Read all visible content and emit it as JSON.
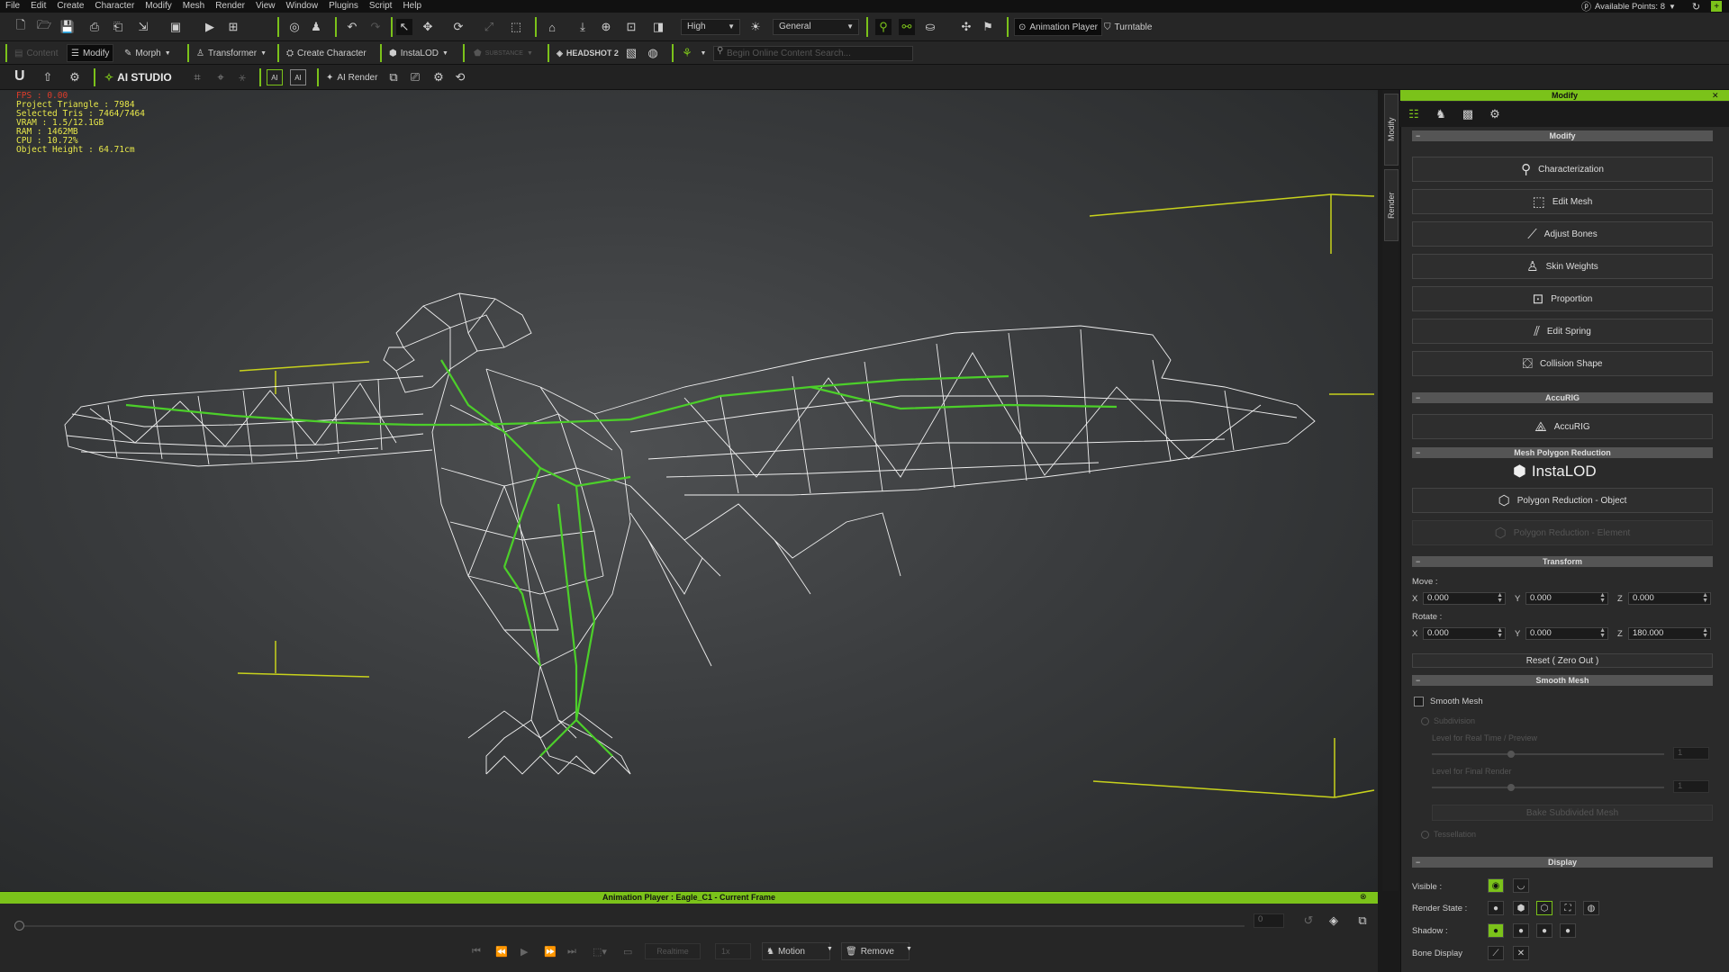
{
  "menu": [
    "File",
    "Edit",
    "Create",
    "Character",
    "Modify",
    "Mesh",
    "Render",
    "View",
    "Window",
    "Plugins",
    "Script",
    "Help"
  ],
  "points": {
    "label": "Available Points: 8"
  },
  "toolbar1": {
    "quality": "High",
    "lighting": "General",
    "animation_player": "Animation Player",
    "turntable": "Turntable"
  },
  "toolbar2": {
    "content": "Content",
    "modify": "Modify",
    "morph": "Morph",
    "transformer": "Transformer",
    "create_character": "Create Character",
    "instalod": "InstaLOD",
    "substance": "SUBSTANCE",
    "headshot": "HEADSHOT 2",
    "search_placeholder": "Begin Online Content Search..."
  },
  "toolbar3": {
    "ai_studio": "AI STUDIO",
    "ai_render": "AI Render"
  },
  "stats": {
    "fps": "FPS : 0.00",
    "tri": "Project Triangle : 7984",
    "sel": "Selected Tris : 7464/7464",
    "vram": "VRAM : 1.5/12.1GB",
    "ram": "RAM : 1462MB",
    "cpu": "CPU : 10.72%",
    "height": "Object Height : 64.71cm"
  },
  "side_tabs": {
    "modify": "Modify",
    "render": "Render"
  },
  "panel": {
    "title": "Modify",
    "sections": {
      "modify": "Modify",
      "accurig": "AccuRIG",
      "mpr": "Mesh Polygon Reduction",
      "transform": "Transform",
      "smooth": "Smooth Mesh",
      "display": "Display"
    },
    "modify_buttons": [
      "Characterization",
      "Edit Mesh",
      "Adjust Bones",
      "Skin Weights",
      "Proportion",
      "Edit Spring",
      "Collision Shape"
    ],
    "accurig_button": "AccuRIG",
    "instalod_logo": "InstaLOD",
    "poly_object": "Polygon Reduction - Object",
    "poly_element": "Polygon Reduction - Element",
    "move_label": "Move :",
    "rotate_label": "Rotate :",
    "axes": [
      "X",
      "Y",
      "Z"
    ],
    "move": [
      "0.000",
      "0.000",
      "0.000"
    ],
    "rotate": [
      "0.000",
      "0.000",
      "180.000"
    ],
    "reset": "Reset ( Zero Out )",
    "smooth_mesh": "Smooth Mesh",
    "subdivision": "Subdivision",
    "level_rt": "Level for Real Time / Preview",
    "level_final": "Level for Final Render",
    "level_rt_val": "1",
    "level_final_val": "1",
    "bake": "Bake Subdivided Mesh",
    "tessellation": "Tessellation",
    "visible": "Visible :",
    "render_state": "Render State :",
    "shadow": "Shadow :",
    "bone_display": "Bone Display"
  },
  "anim": {
    "title": "Animation Player : Eagle_C1 - Current Frame",
    "frame": "0",
    "realtime": "Realtime",
    "speed": "1x",
    "motion": "Motion",
    "remove": "Remove"
  },
  "colors": {
    "accent": "#7bc21a",
    "wire": "#ffffff",
    "bone": "#4ccf2a",
    "bbox": "#c8d21c"
  }
}
